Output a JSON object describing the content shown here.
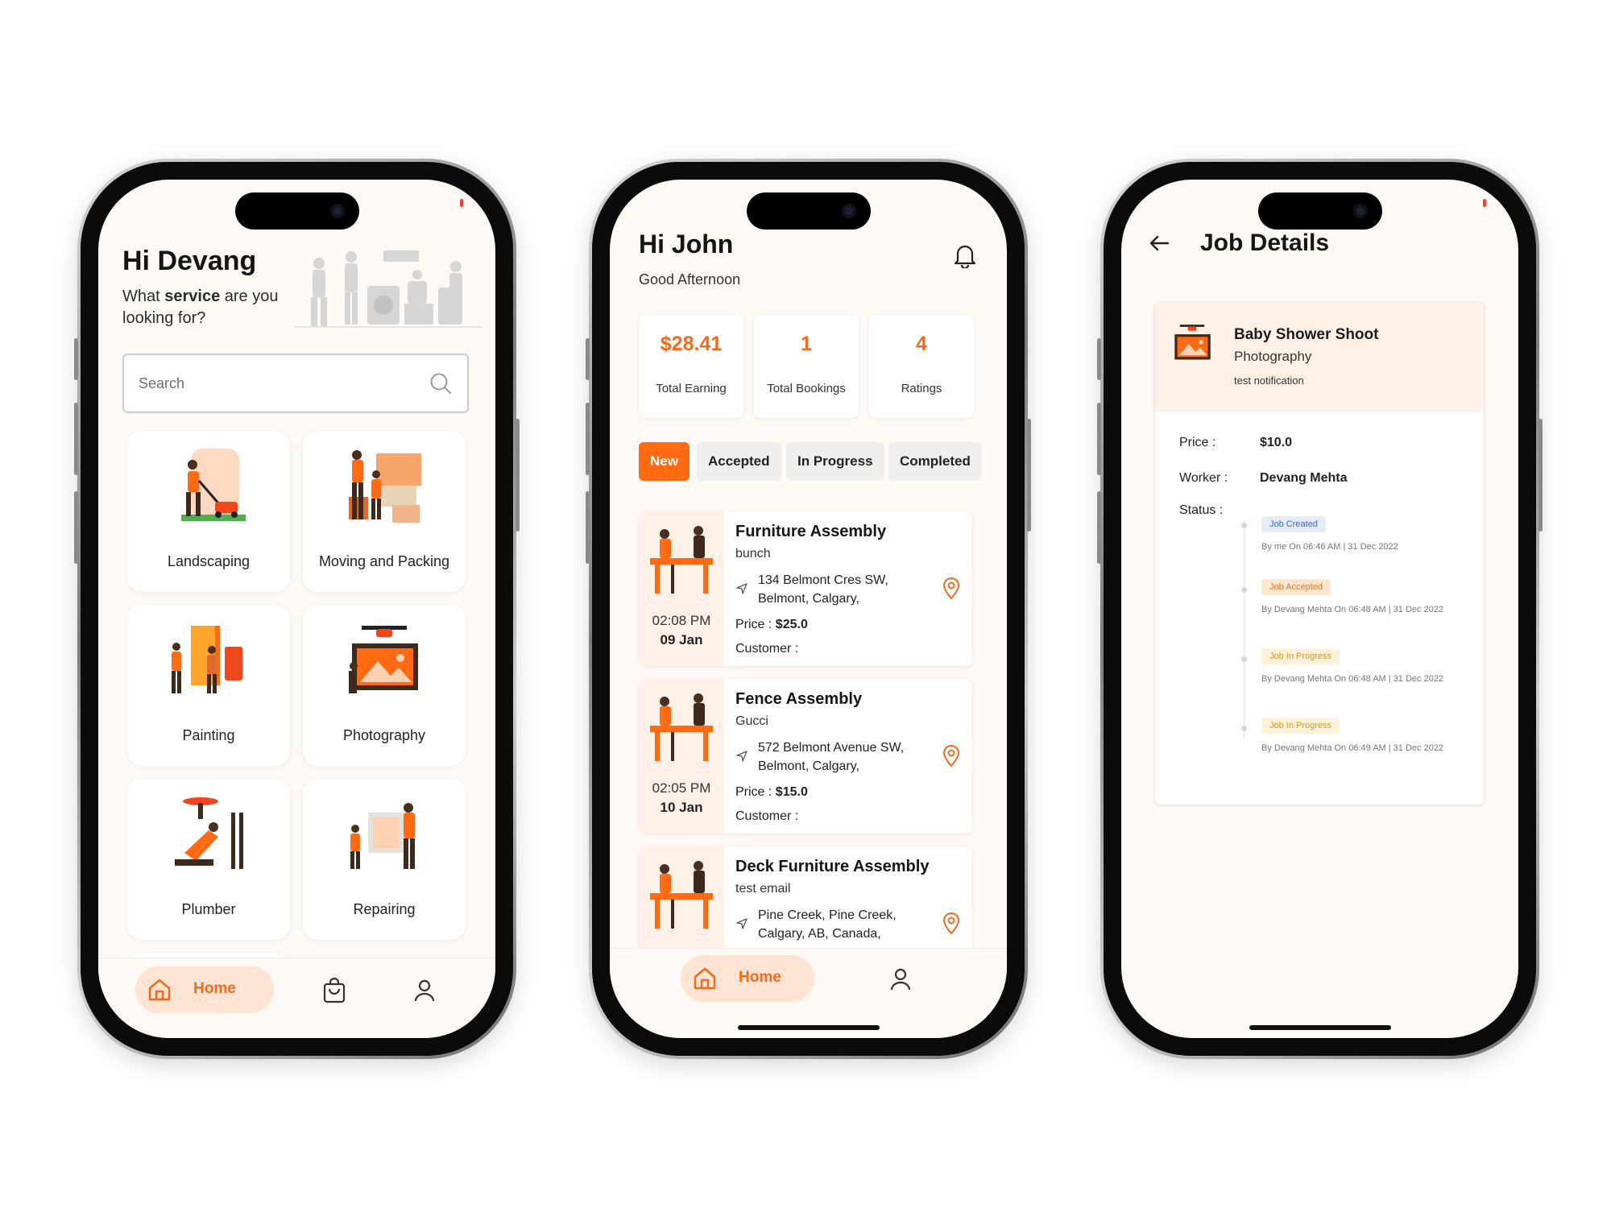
{
  "colors": {
    "accent": "#ff6a13",
    "accent_soft": "#ffe3d3",
    "screen_bg": "#fff9f6"
  },
  "home": {
    "greeting": "Hi Devang",
    "subtitle_pre": "What ",
    "subtitle_bold": "service",
    "subtitle_post": " are you looking for?",
    "search_placeholder": "Search",
    "categories": [
      {
        "label": "Landscaping",
        "icon": "lawn-mower-illustration"
      },
      {
        "label": "Moving and Packing",
        "icon": "moving-boxes-illustration"
      },
      {
        "label": "Painting",
        "icon": "painters-illustration"
      },
      {
        "label": "Photography",
        "icon": "drone-camera-illustration"
      },
      {
        "label": "Plumber",
        "icon": "plumber-illustration"
      },
      {
        "label": "Repairing",
        "icon": "repair-workers-illustration"
      }
    ],
    "nav": {
      "home_label": "Home",
      "icons": [
        "home-icon",
        "bag-icon",
        "profile-icon"
      ]
    }
  },
  "dashboard": {
    "greeting": "Hi John",
    "subtitle": "Good Afternoon",
    "stats": [
      {
        "value": "$28.41",
        "label": "Total Earning"
      },
      {
        "value": "1",
        "label": "Total Bookings"
      },
      {
        "value": "4",
        "label": "Ratings"
      }
    ],
    "tabs": [
      "New",
      "Accepted",
      "In Progress",
      "Completed"
    ],
    "active_tab": "New",
    "price_label": "Price : ",
    "customer_label": "Customer :",
    "jobs": [
      {
        "title": "Furniture Assembly",
        "client": "bunch",
        "address": "134 Belmont Cres SW, Belmont, Calgary,",
        "price": "$25.0",
        "time": "02:08 PM",
        "date": "09 Jan"
      },
      {
        "title": "Fence Assembly",
        "client": "Gucci",
        "address": "572 Belmont Avenue SW, Belmont, Calgary,",
        "price": "$15.0",
        "time": "02:05 PM",
        "date": "10 Jan"
      },
      {
        "title": "Deck Furniture Assembly",
        "client": "test email",
        "address": "Pine Creek, Pine Creek, Calgary, AB, Canada,",
        "price": "",
        "time": "",
        "date": ""
      }
    ],
    "nav": {
      "home_label": "Home"
    }
  },
  "job_details": {
    "title": "Job Details",
    "job_title": "Baby Shower Shoot",
    "category": "Photography",
    "note": "test notification",
    "price_label": "Price :",
    "price": "$10.0",
    "worker_label": "Worker :",
    "worker": "Devang Mehta",
    "status_label": "Status :",
    "timeline": [
      {
        "status": "Job Created",
        "by": "By me On 06:46 AM | 31 Dec 2022",
        "tone": "blue"
      },
      {
        "status": "Job Accepted",
        "by": "By Devang Mehta On 06:48 AM | 31 Dec 2022",
        "tone": "orange"
      },
      {
        "status": "Job In Progress",
        "by": "By Devang Mehta On 06:48 AM | 31 Dec 2022",
        "tone": "yellow"
      },
      {
        "status": "Job In Progress",
        "by": "By Devang Mehta On 06:49 AM | 31 Dec 2022",
        "tone": "yellow"
      }
    ]
  }
}
